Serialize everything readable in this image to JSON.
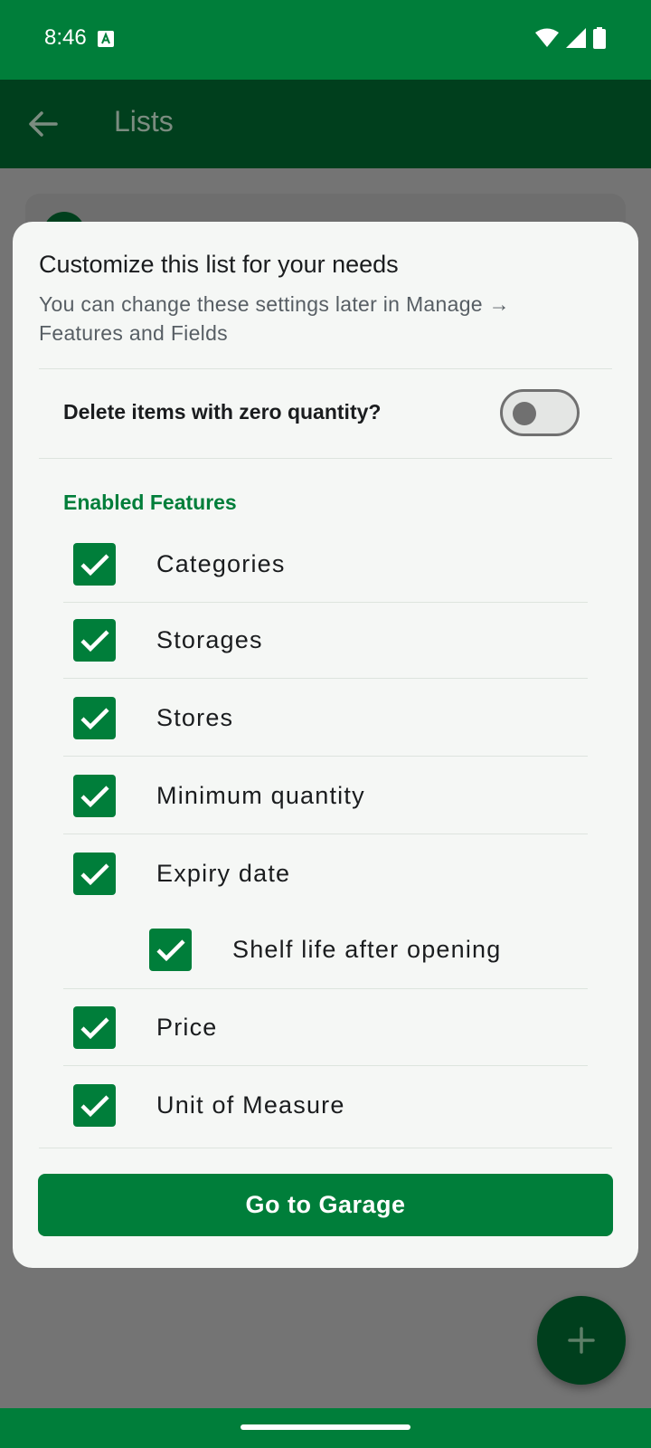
{
  "status_bar": {
    "time": "8:46",
    "icons": [
      "a-badge-icon",
      "wifi-icon",
      "signal-icon",
      "battery-icon"
    ]
  },
  "app_bar": {
    "title": "Lists",
    "back_icon": "arrow-left-icon"
  },
  "dialog": {
    "title": "Customize this list for your needs",
    "subtitle": "You can change these settings later in Manage → Features and Fields",
    "delete_zero_label": "Delete items with zero quantity?",
    "delete_zero_enabled": false,
    "section_label": "Enabled Features",
    "features": [
      {
        "label": "Categories",
        "checked": true
      },
      {
        "label": "Storages",
        "checked": true
      },
      {
        "label": "Stores",
        "checked": true
      },
      {
        "label": "Minimum quantity",
        "checked": true
      },
      {
        "label": "Expiry date",
        "checked": true
      },
      {
        "label": "Shelf life after opening",
        "checked": true,
        "sub": true
      },
      {
        "label": "Price",
        "checked": true
      },
      {
        "label": "Unit of Measure",
        "checked": true
      }
    ],
    "button_label": "Go to Garage"
  },
  "fab": {
    "icon": "plus-icon"
  },
  "colors": {
    "primary": "#007E3A",
    "primary_dim": "#003F1D",
    "scrim": "#747474",
    "surface": "#F5F7F5"
  }
}
